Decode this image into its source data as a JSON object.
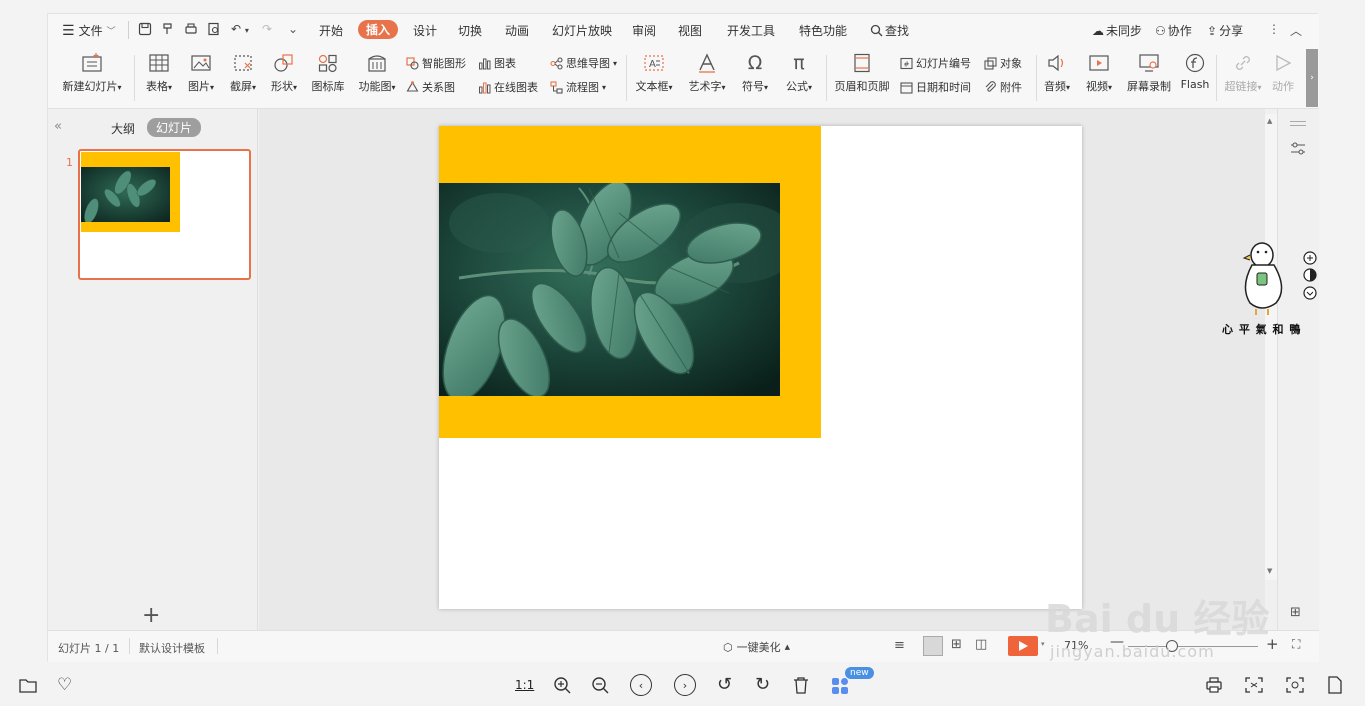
{
  "menubar": {
    "file_label": "文件",
    "tabs": [
      "开始",
      "插入",
      "设计",
      "切换",
      "动画",
      "幻灯片放映",
      "审阅",
      "视图",
      "开发工具",
      "特色功能"
    ],
    "active_tab": "插入",
    "search_label": "查找",
    "sync_label": "未同步",
    "collab_label": "协作",
    "share_label": "分享"
  },
  "ribbon": {
    "new_slide": "新建幻灯片",
    "table": "表格",
    "picture": "图片",
    "screenshot": "截屏",
    "shape": "形状",
    "icon_lib": "图标库",
    "func_chart": "功能图",
    "smart_shape": "智能图形",
    "chart": "图表",
    "relation": "关系图",
    "online_chart": "在线图表",
    "mindmap": "思维导图",
    "flowchart": "流程图",
    "textbox": "文本框",
    "wordart": "艺术字",
    "symbol": "符号",
    "formula": "公式",
    "header_footer": "页眉和页脚",
    "slide_number": "幻灯片编号",
    "object": "对象",
    "datetime": "日期和时间",
    "attachment": "附件",
    "audio": "音频",
    "video": "视频",
    "screen_record": "屏幕录制",
    "flash": "Flash",
    "hyperlink": "超链接",
    "action": "动作"
  },
  "panel": {
    "outline_tab": "大纲",
    "slides_tab": "幻灯片",
    "slide_number": "1",
    "add_symbol": "+"
  },
  "statusbar": {
    "slide_info": "幻灯片 1 / 1",
    "template": "默认设计模板",
    "beautify": "一键美化",
    "zoom": "71%"
  },
  "bottombar": {
    "ratio_label": "1:1",
    "new_badge": "new"
  },
  "colors": {
    "accent": "#e8734a",
    "slide_yellow": "#ffc000",
    "leaf_dark": "#0f2a22"
  },
  "mascot": {
    "caption": "心 平 氣 和 鴨"
  },
  "watermark": {
    "brand": "Bai du 经验",
    "url": "jingyan.baidu.com"
  }
}
